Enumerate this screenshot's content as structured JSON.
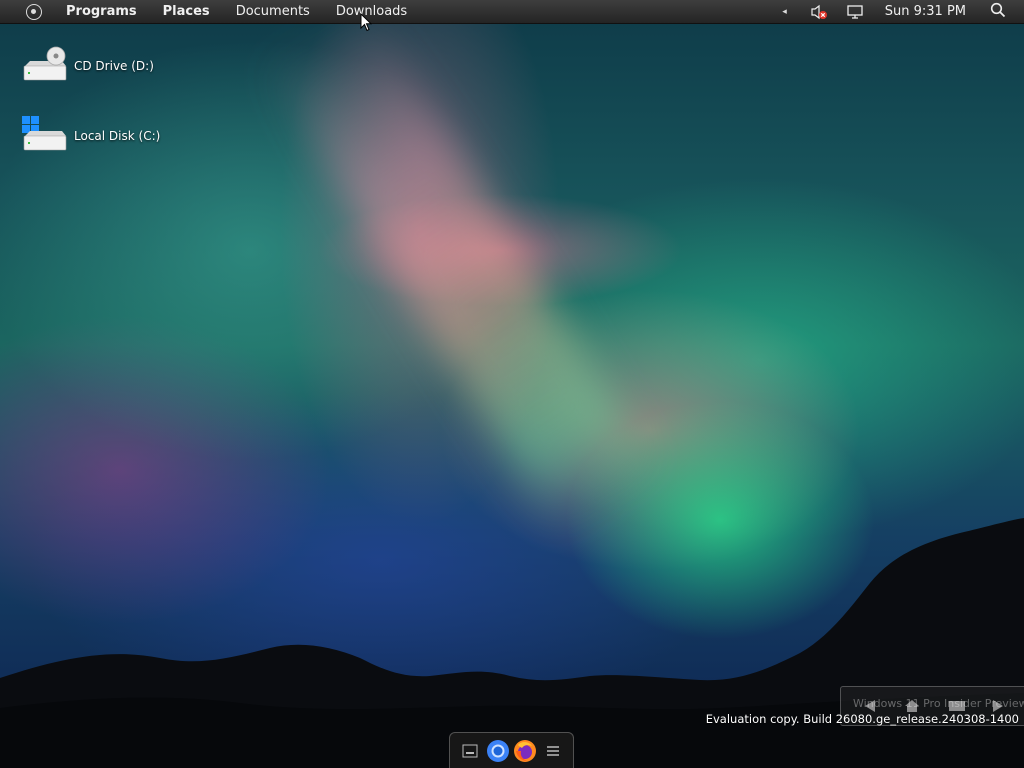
{
  "top_panel": {
    "menu": {
      "programs": "Programs",
      "places": "Places",
      "documents": "Documents",
      "downloads": "Downloads"
    },
    "tray": {
      "expand_arrow": "◂",
      "volume_icon": "speaker-muted-icon",
      "network_icon": "monitor-icon",
      "clock": "Sun 9:31 PM",
      "search_icon": "search-icon"
    }
  },
  "desktop": {
    "icons": [
      {
        "label": "CD Drive (D:)",
        "icon": "cd-drive-icon"
      },
      {
        "label": "Local Disk (C:)",
        "icon": "local-disk-icon"
      }
    ]
  },
  "watermark": {
    "title": "Windows 11 Pro Insider Preview",
    "build": "Evaluation copy. Build 26080.ge_release.240308-1400"
  },
  "dock": {
    "items": [
      {
        "icon": "show-desktop-icon"
      },
      {
        "icon": "chrome-icon"
      },
      {
        "icon": "firefox-icon"
      },
      {
        "icon": "menu-icon"
      }
    ]
  },
  "colors": {
    "panel_bg": "#2e2e2e",
    "mute_red": "#e0362c",
    "windows_blue": "#1e90ff"
  }
}
